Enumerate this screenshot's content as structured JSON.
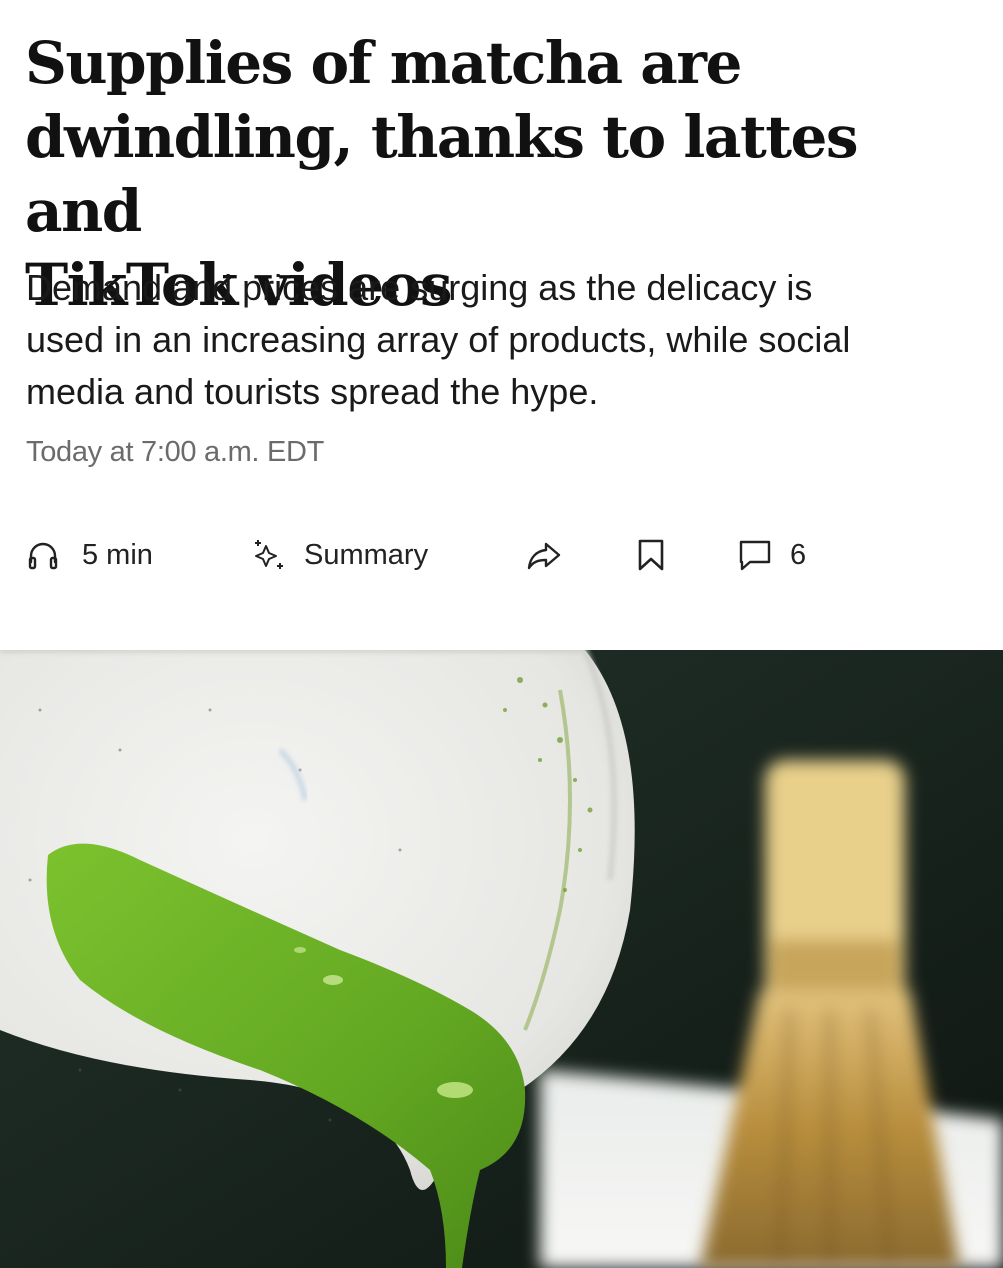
{
  "article": {
    "headline_line1": "Supplies of matcha are",
    "headline_line2": "dwindling, thanks to lattes and",
    "headline_line3": "TikTok videos",
    "dek_line1": "Demand and prices are surging as the delicacy is",
    "dek_line2": "used in an increasing array of products, while social",
    "dek_line3": "media and tourists spread the hype.",
    "timestamp": "Today at 7:00 a.m. EDT"
  },
  "actions": {
    "listen_label": "5 min",
    "listen_icon": "headphones-icon",
    "summary_label": "Summary",
    "summary_icon": "sparkle-icon",
    "share_icon": "share-arrow-icon",
    "save_icon": "bookmark-icon",
    "comments_icon": "comment-icon",
    "comments_count": "6"
  },
  "colors": {
    "text": "#111111",
    "meta": "#6b6b6b",
    "matcha_green": "#6fb52a"
  }
}
